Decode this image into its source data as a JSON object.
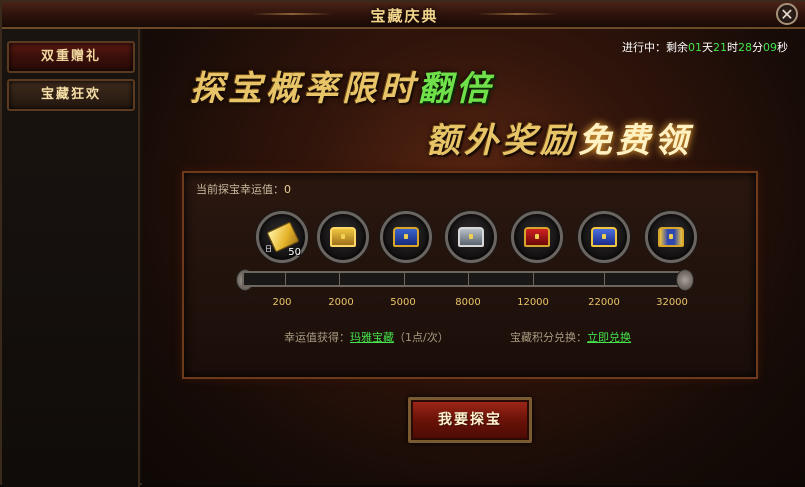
{
  "window": {
    "title": "宝藏庆典",
    "close_label": "✕"
  },
  "sidebar": {
    "items": [
      {
        "label": "双重赠礼"
      },
      {
        "label": "宝藏狂欢"
      }
    ]
  },
  "timer": {
    "prefix": "进行中：剩余",
    "days": "01",
    "days_unit": "天",
    "hours": "21",
    "hours_unit": "时",
    "minutes": "28",
    "minutes_unit": "分",
    "seconds": "09",
    "seconds_unit": "秒"
  },
  "banner": {
    "line1": "探宝概率限时",
    "line1_highlight": "翻倍",
    "line2": "额外奖励",
    "line2_highlight": "免费领"
  },
  "luck": {
    "label": "当前探宝幸运值：",
    "value": "0"
  },
  "rewards": [
    {
      "icon": "scroll-reward-icon",
      "count": "50",
      "tag": "日"
    },
    {
      "icon": "gold-chest-icon"
    },
    {
      "icon": "blue-chest-icon"
    },
    {
      "icon": "silver-chest-icon"
    },
    {
      "icon": "red-chest-icon"
    },
    {
      "icon": "blue-gold-chest-icon"
    },
    {
      "icon": "royal-chest-icon"
    }
  ],
  "progress": {
    "value": 0,
    "thresholds": [
      "200",
      "2000",
      "5000",
      "8000",
      "12000",
      "22000",
      "32000"
    ]
  },
  "info": {
    "gain_label": "幸运值获得：",
    "gain_link": "玛雅宝藏",
    "gain_note": "（1点/次）",
    "exchange_label": "宝藏积分兑换：",
    "exchange_link": "立即兑换"
  },
  "action": {
    "label": "我要探宝"
  },
  "colors": {
    "accent_gold": "#e8c468",
    "accent_green": "#45e24a",
    "button_red": "#a0281a"
  }
}
